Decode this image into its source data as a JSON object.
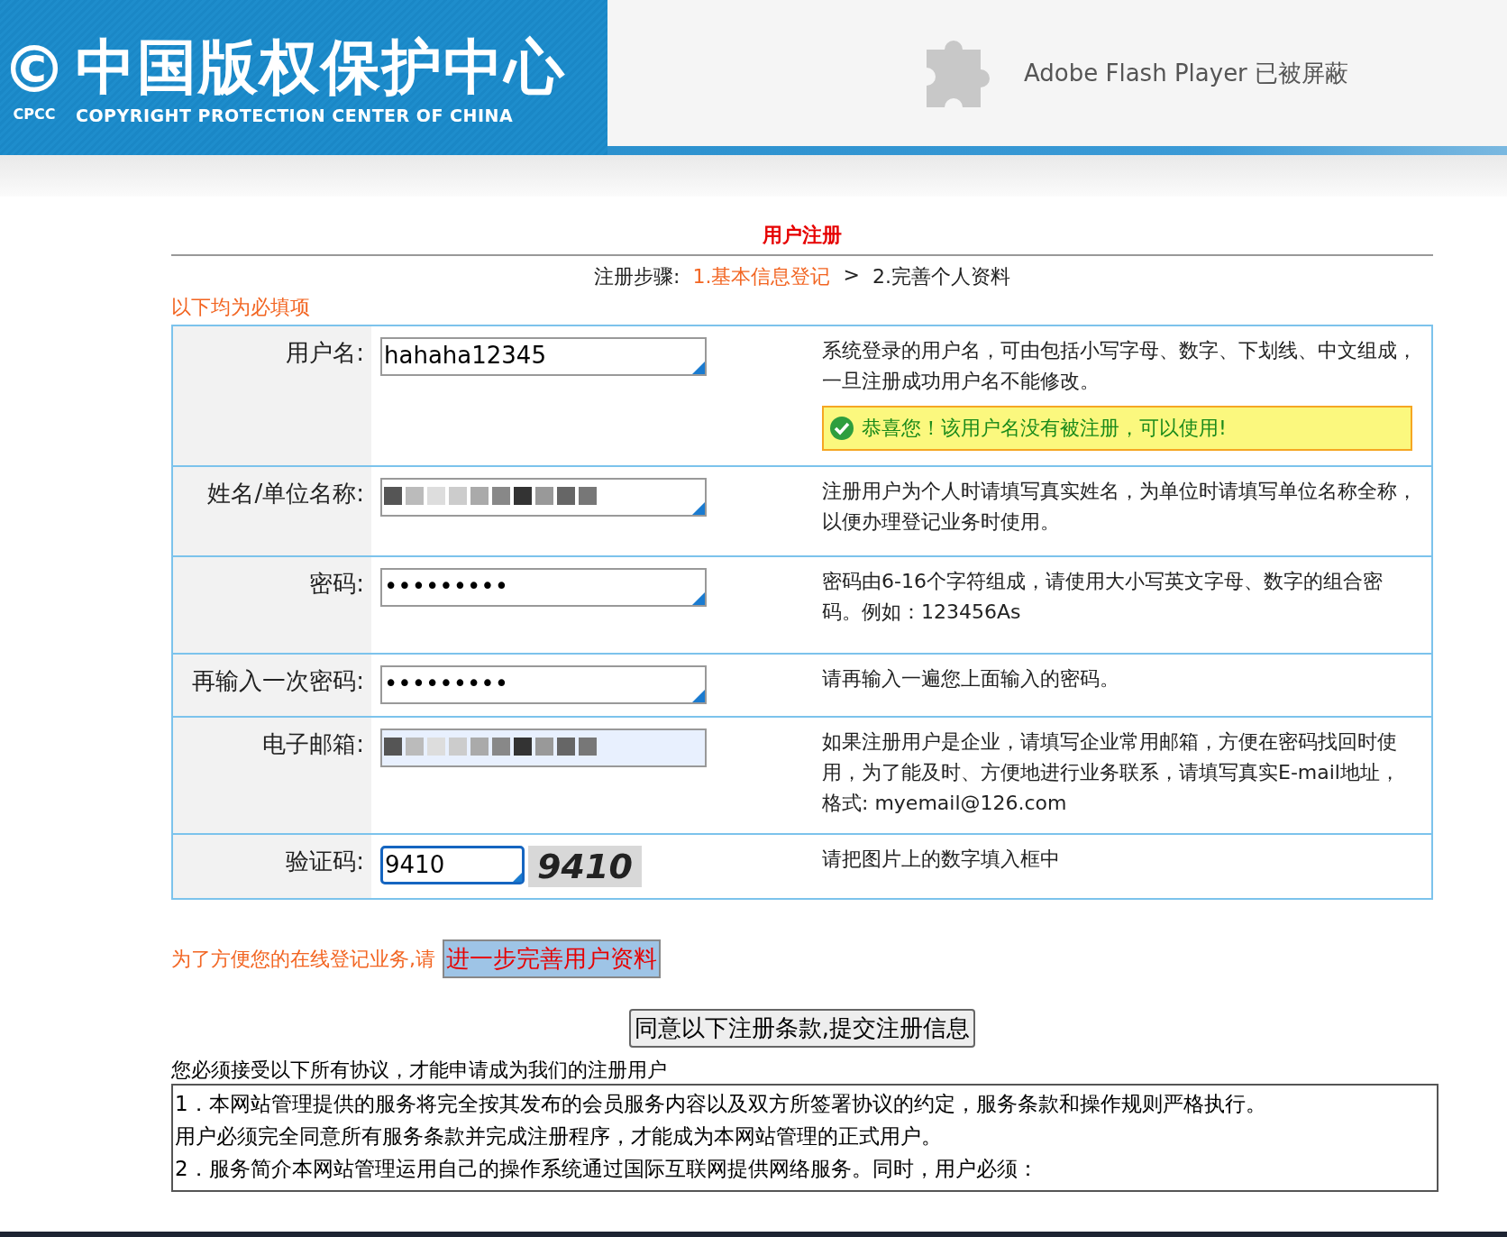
{
  "header": {
    "logo_mark": "©",
    "logo_abbr": "CPCC",
    "logo_title": "中国版权保护中心",
    "logo_subtitle": "COPYRIGHT PROTECTION CENTER OF CHINA",
    "plugin_notice": "Adobe Flash Player 已被屏蔽"
  },
  "title": "用户注册",
  "steps": {
    "label": "注册步骤:",
    "items": [
      {
        "text": "1.基本信息登记",
        "selected": true
      },
      {
        "text": "2.完善个人资料",
        "selected": false
      }
    ],
    "separator": ">"
  },
  "required_note": "以下均为必填项",
  "fields": [
    {
      "label": "用户名:",
      "kind": "text",
      "value": "hahaha12345",
      "focused": false,
      "help": "系统登录的用户名，可由包括小写字母、数字、下划线、中文组成，一旦注册成功用户名不能修改。",
      "notice": "恭喜您！该用户名没有被注册，可以使用!"
    },
    {
      "label": "姓名/单位名称:",
      "kind": "redacted",
      "focused": false,
      "autofilled": false,
      "help": "注册用户为个人时请填写真实姓名，为单位时请填写单位名称全称，以便办理登记业务时使用。"
    },
    {
      "label": "密码:",
      "kind": "text",
      "value": "•••••••••",
      "focused": false,
      "help": "密码由6-16个字符组成，请使用大小写英文字母、数字的组合密码。例如：123456As"
    },
    {
      "label": "再输入一次密码:",
      "kind": "text",
      "value": "•••••••••",
      "focused": false,
      "help": "请再输入一遍您上面输入的密码。"
    },
    {
      "label": "电子邮箱:",
      "kind": "redacted",
      "focused": false,
      "autofilled": true,
      "help": "如果注册用户是企业，请填写企业常用邮箱，方便在密码找回时使用，为了能及时、方便地进行业务联系，请填写真实E-mail地址，格式: myemail@126.com"
    },
    {
      "label": "验证码:",
      "kind": "captcha",
      "value": "9410",
      "captcha_text": "9410",
      "focused": true,
      "help": "请把图片上的数字填入框中"
    }
  ],
  "promo": {
    "text": "为了方便您的在线登记业务,请",
    "link": "进一步完善用户资料"
  },
  "submit_button": "同意以下注册条款,提交注册信息",
  "agreement_intro": "您必须接受以下所有协议，才能申请成为我们的注册用户",
  "agreement_lines": [
    "1．本网站管理提供的服务将完全按其发布的会员服务内容以及双方所签署协议的约定，服务条款和操作规则严格执行。",
    "用户必须完全同意所有服务条款并完成注册程序，才能成为本网站管理的正式用户。",
    "2．服务简介本网站管理运用自己的操作系统通过国际互联网提供网络服务。同时，用户必须："
  ]
}
